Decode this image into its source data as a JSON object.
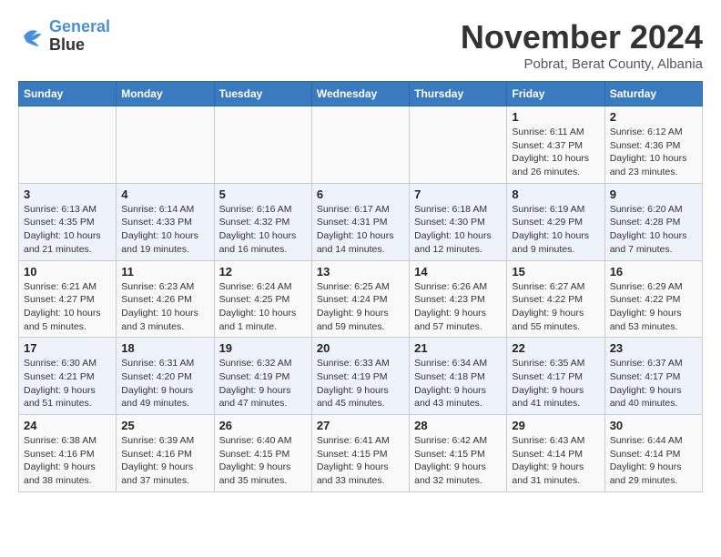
{
  "logo": {
    "line1": "General",
    "line2": "Blue"
  },
  "title": "November 2024",
  "subtitle": "Pobrat, Berat County, Albania",
  "weekdays": [
    "Sunday",
    "Monday",
    "Tuesday",
    "Wednesday",
    "Thursday",
    "Friday",
    "Saturday"
  ],
  "weeks": [
    [
      {
        "day": "",
        "info": ""
      },
      {
        "day": "",
        "info": ""
      },
      {
        "day": "",
        "info": ""
      },
      {
        "day": "",
        "info": ""
      },
      {
        "day": "",
        "info": ""
      },
      {
        "day": "1",
        "info": "Sunrise: 6:11 AM\nSunset: 4:37 PM\nDaylight: 10 hours and 26 minutes."
      },
      {
        "day": "2",
        "info": "Sunrise: 6:12 AM\nSunset: 4:36 PM\nDaylight: 10 hours and 23 minutes."
      }
    ],
    [
      {
        "day": "3",
        "info": "Sunrise: 6:13 AM\nSunset: 4:35 PM\nDaylight: 10 hours and 21 minutes."
      },
      {
        "day": "4",
        "info": "Sunrise: 6:14 AM\nSunset: 4:33 PM\nDaylight: 10 hours and 19 minutes."
      },
      {
        "day": "5",
        "info": "Sunrise: 6:16 AM\nSunset: 4:32 PM\nDaylight: 10 hours and 16 minutes."
      },
      {
        "day": "6",
        "info": "Sunrise: 6:17 AM\nSunset: 4:31 PM\nDaylight: 10 hours and 14 minutes."
      },
      {
        "day": "7",
        "info": "Sunrise: 6:18 AM\nSunset: 4:30 PM\nDaylight: 10 hours and 12 minutes."
      },
      {
        "day": "8",
        "info": "Sunrise: 6:19 AM\nSunset: 4:29 PM\nDaylight: 10 hours and 9 minutes."
      },
      {
        "day": "9",
        "info": "Sunrise: 6:20 AM\nSunset: 4:28 PM\nDaylight: 10 hours and 7 minutes."
      }
    ],
    [
      {
        "day": "10",
        "info": "Sunrise: 6:21 AM\nSunset: 4:27 PM\nDaylight: 10 hours and 5 minutes."
      },
      {
        "day": "11",
        "info": "Sunrise: 6:23 AM\nSunset: 4:26 PM\nDaylight: 10 hours and 3 minutes."
      },
      {
        "day": "12",
        "info": "Sunrise: 6:24 AM\nSunset: 4:25 PM\nDaylight: 10 hours and 1 minute."
      },
      {
        "day": "13",
        "info": "Sunrise: 6:25 AM\nSunset: 4:24 PM\nDaylight: 9 hours and 59 minutes."
      },
      {
        "day": "14",
        "info": "Sunrise: 6:26 AM\nSunset: 4:23 PM\nDaylight: 9 hours and 57 minutes."
      },
      {
        "day": "15",
        "info": "Sunrise: 6:27 AM\nSunset: 4:22 PM\nDaylight: 9 hours and 55 minutes."
      },
      {
        "day": "16",
        "info": "Sunrise: 6:29 AM\nSunset: 4:22 PM\nDaylight: 9 hours and 53 minutes."
      }
    ],
    [
      {
        "day": "17",
        "info": "Sunrise: 6:30 AM\nSunset: 4:21 PM\nDaylight: 9 hours and 51 minutes."
      },
      {
        "day": "18",
        "info": "Sunrise: 6:31 AM\nSunset: 4:20 PM\nDaylight: 9 hours and 49 minutes."
      },
      {
        "day": "19",
        "info": "Sunrise: 6:32 AM\nSunset: 4:19 PM\nDaylight: 9 hours and 47 minutes."
      },
      {
        "day": "20",
        "info": "Sunrise: 6:33 AM\nSunset: 4:19 PM\nDaylight: 9 hours and 45 minutes."
      },
      {
        "day": "21",
        "info": "Sunrise: 6:34 AM\nSunset: 4:18 PM\nDaylight: 9 hours and 43 minutes."
      },
      {
        "day": "22",
        "info": "Sunrise: 6:35 AM\nSunset: 4:17 PM\nDaylight: 9 hours and 41 minutes."
      },
      {
        "day": "23",
        "info": "Sunrise: 6:37 AM\nSunset: 4:17 PM\nDaylight: 9 hours and 40 minutes."
      }
    ],
    [
      {
        "day": "24",
        "info": "Sunrise: 6:38 AM\nSunset: 4:16 PM\nDaylight: 9 hours and 38 minutes."
      },
      {
        "day": "25",
        "info": "Sunrise: 6:39 AM\nSunset: 4:16 PM\nDaylight: 9 hours and 37 minutes."
      },
      {
        "day": "26",
        "info": "Sunrise: 6:40 AM\nSunset: 4:15 PM\nDaylight: 9 hours and 35 minutes."
      },
      {
        "day": "27",
        "info": "Sunrise: 6:41 AM\nSunset: 4:15 PM\nDaylight: 9 hours and 33 minutes."
      },
      {
        "day": "28",
        "info": "Sunrise: 6:42 AM\nSunset: 4:15 PM\nDaylight: 9 hours and 32 minutes."
      },
      {
        "day": "29",
        "info": "Sunrise: 6:43 AM\nSunset: 4:14 PM\nDaylight: 9 hours and 31 minutes."
      },
      {
        "day": "30",
        "info": "Sunrise: 6:44 AM\nSunset: 4:14 PM\nDaylight: 9 hours and 29 minutes."
      }
    ]
  ]
}
